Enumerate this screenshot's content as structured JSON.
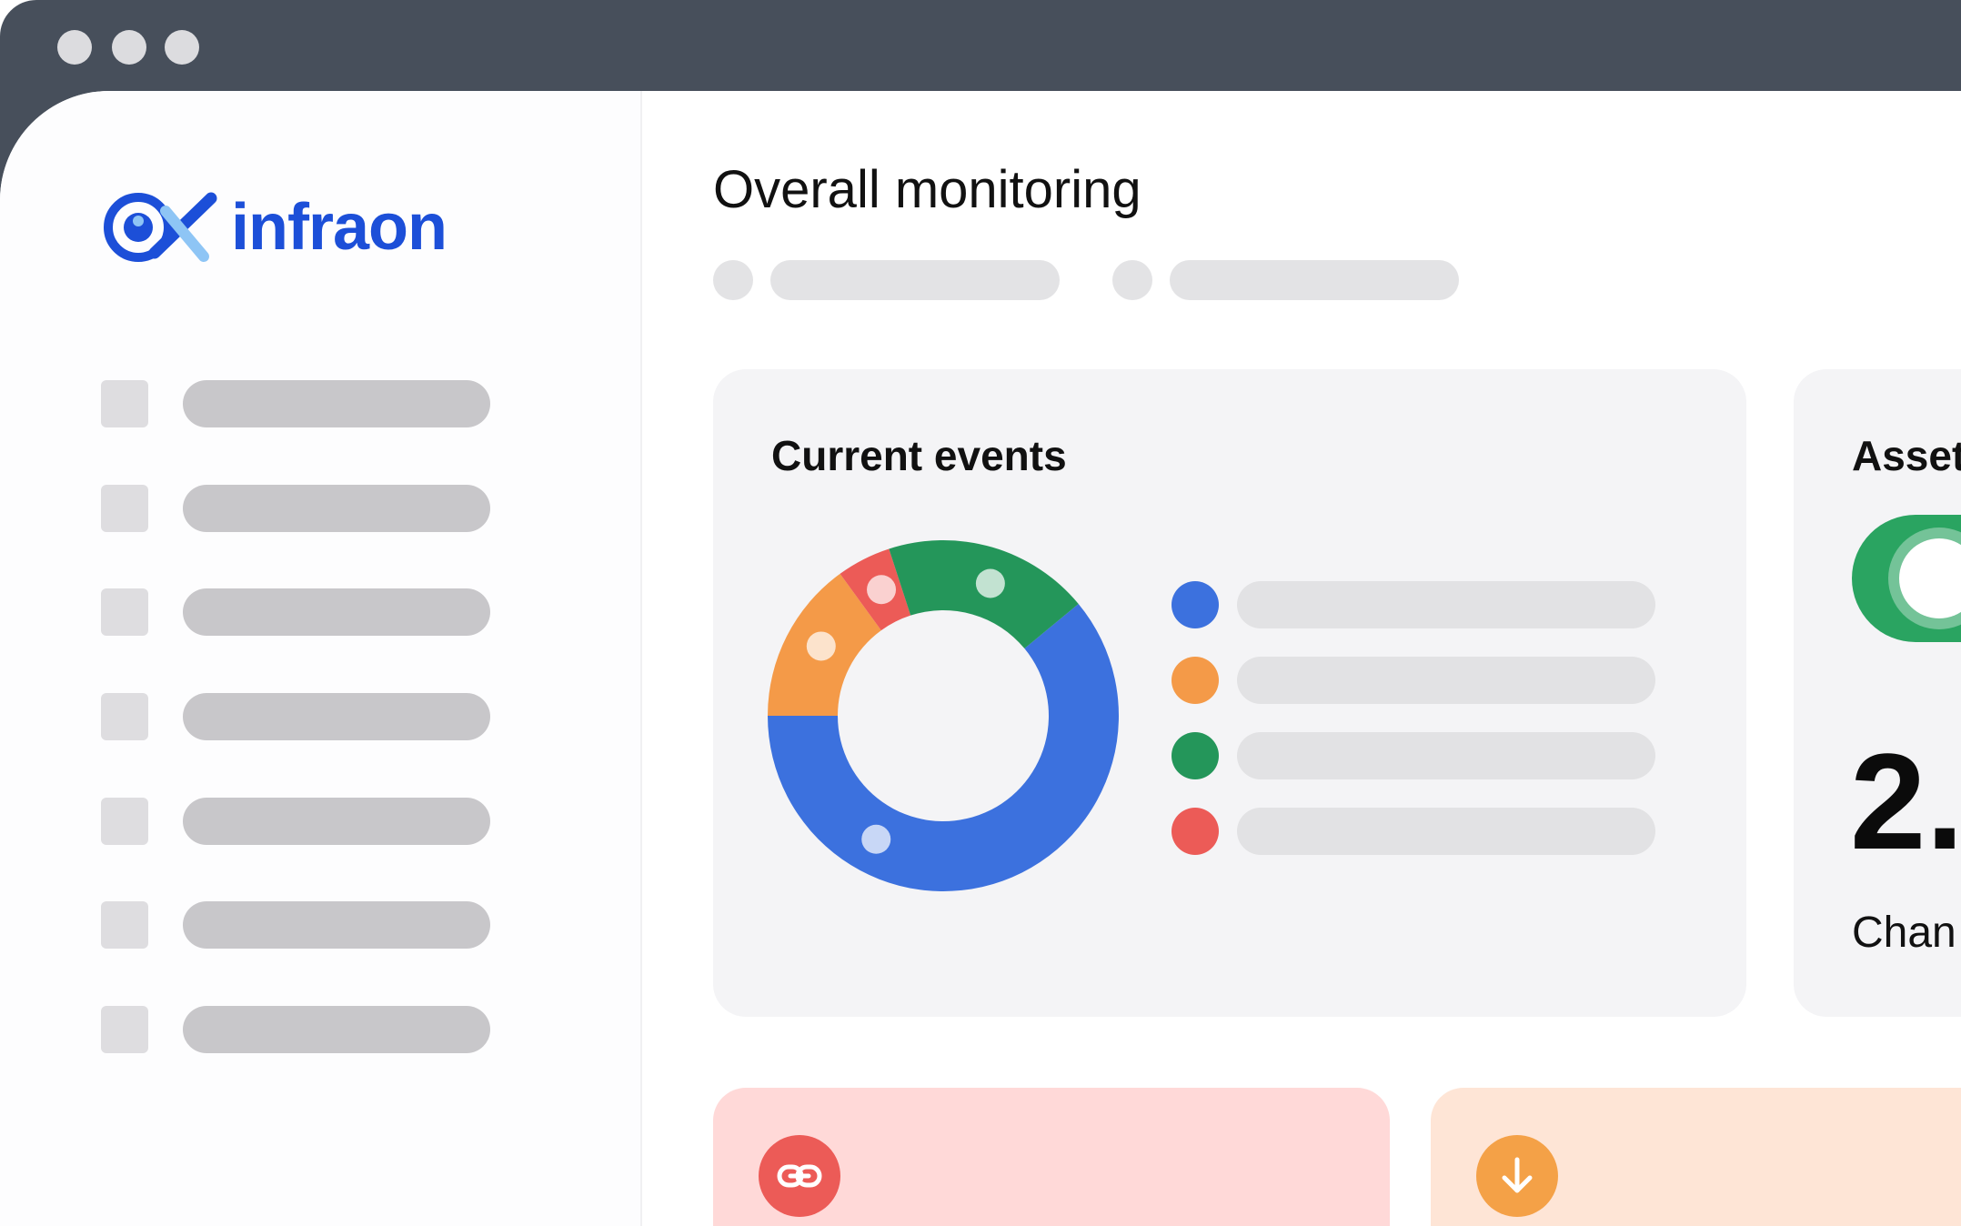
{
  "theme": {
    "brand": "#1c4fd8",
    "donut_blue": "#3c71de",
    "donut_orange": "#f49a48",
    "donut_red": "#ec5b57",
    "donut_green": "#24965a",
    "toggle_green": "#2aa461",
    "tile_red_bg": "#ffd9d8",
    "tile_orange_bg": "#fee5d6",
    "tile_red_icon": "#ec5b57",
    "tile_orange_icon": "#f4a147"
  },
  "logo": {
    "text": "infraon",
    "icon": "eye-x-logo-icon"
  },
  "page": {
    "title": "Overall monitoring"
  },
  "current_events": {
    "title": "Current events",
    "chart_data": {
      "type": "pie",
      "values": [
        61,
        15,
        5,
        19
      ],
      "colors": [
        "#3c71de",
        "#f49a48",
        "#ec5b57",
        "#24965a"
      ]
    }
  },
  "assets": {
    "title": "Asset",
    "value": "2.",
    "caption": "Chan"
  },
  "tiles": [
    {
      "icon": "link-icon"
    },
    {
      "icon": "arrow-down-icon"
    }
  ]
}
